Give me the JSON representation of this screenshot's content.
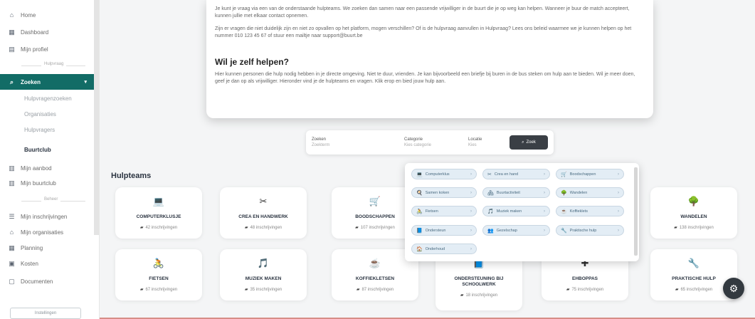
{
  "sidebar": {
    "items": [
      {
        "label": "Home",
        "icon": "home-icon",
        "glyph": "⌂"
      },
      {
        "label": "Dashboard",
        "icon": "dashboard-icon",
        "glyph": "▦"
      },
      {
        "label": "Mijn profiel",
        "icon": "profile-icon",
        "glyph": "▤"
      }
    ],
    "section_hulpvraag": "Hulpvraag",
    "active": {
      "label": "Zoeken",
      "icon": "search-icon",
      "glyph": "⌕"
    },
    "sub_items": [
      "Hulpvragenzoeken",
      "Organisaties",
      "Hulpvragers",
      "Buurtclub"
    ],
    "more_items": [
      {
        "label": "Mijn aanbod",
        "icon": "offer-icon",
        "glyph": "▥"
      },
      {
        "label": "Mijn buurtclub",
        "icon": "club-icon",
        "glyph": "▥"
      }
    ],
    "section_beheer": "Beheer",
    "beheer_items": [
      {
        "label": "Mijn inschrijvingen",
        "icon": "signup-icon",
        "glyph": "☰"
      },
      {
        "label": "Mijn organisaties",
        "icon": "organisation-icon",
        "glyph": "⌂"
      },
      {
        "label": "Planning",
        "icon": "calendar-icon",
        "glyph": "▦"
      },
      {
        "label": "Kosten",
        "icon": "costs-icon",
        "glyph": "▣"
      },
      {
        "label": "Documenten",
        "icon": "documents-icon",
        "glyph": "▢"
      }
    ],
    "bottom_button": "Instellingen"
  },
  "info": {
    "p1": "Je kunt je vraag via een van de onderstaande hulpteams. We zoeken dan samen naar een passende vrijwilliger in de buurt die je op weg kan helpen. Wanneer je buur de match accepteert, kunnen jullie met elkaar contact opnemen.",
    "p2": "Zijn er vragen die niet duidelijk zijn en niet zo opvallen op het platform, mogen verschillen? Of is de hulpvraag aanvullen in Hulpvraag? Lees ons beleid waarmee we je kunnen helpen op het nummer 010 123 45 67 of stuur een mailtje naar support@buurt.be",
    "heading": "Wil je zelf helpen?",
    "p3": "Hier kunnen personen die hulp nodig hebben in je directe omgeving. Niet te duur, vrienden. Je kan bijvoorbeeld een briefje bij buren in de bus steken om hulp aan te bieden. Wil je meer doen, geef je dan op als vrijwilliger. Hieronder vind je de hulpteams en vragen. Klik erop en bied jouw hulp aan."
  },
  "search": {
    "label_zoeken": "Zoeken",
    "value_zoeken": "Zoekterm",
    "label_categorie": "Categorie",
    "value_categorie": "Kies categorie",
    "label_locatie": "Locatie",
    "value_locatie": "Kies",
    "button": "Zoek"
  },
  "section_title": "Hulpteams",
  "teams": [
    {
      "name": "COMPUTERKLUSJE",
      "count": "42 inschrijvingen",
      "emoji": "💻"
    },
    {
      "name": "CREA EN HANDWERK",
      "count": "48 inschrijvingen",
      "emoji": "✂"
    },
    {
      "name": "BOODSCHAPPEN",
      "count": "107 inschrijvingen",
      "emoji": "🛒"
    },
    {
      "name": "WANDELEN",
      "count": "138 inschrijvingen",
      "emoji": "🌳"
    },
    {
      "name": "FIETSEN",
      "count": "67 inschrijvingen",
      "emoji": "🚴"
    },
    {
      "name": "MUZIEK MAKEN",
      "count": "35 inschrijvingen",
      "emoji": "🎵"
    },
    {
      "name": "KOFFIEKLETSEN",
      "count": "87 inschrijvingen",
      "emoji": "☕"
    },
    {
      "name": "ONDERSTEUNING BIJ SCHOOLWERK",
      "count": "18 inschrijvingen",
      "emoji": "📘"
    },
    {
      "name": "EHBOPPAS",
      "count": "75 inschrijvingen",
      "emoji": "✚"
    },
    {
      "name": "PRAKTISCHE HULP",
      "count": "65 inschrijvingen",
      "emoji": "🔧"
    }
  ],
  "chips": [
    {
      "label": "Computerklus",
      "emoji": "💻"
    },
    {
      "label": "Crea en hand",
      "emoji": "✂"
    },
    {
      "label": "Boodschappen",
      "emoji": "🛒"
    },
    {
      "label": "Samen koken",
      "emoji": "🍳"
    },
    {
      "label": "Buurtactiviteit",
      "emoji": "🏘"
    },
    {
      "label": "Wandelen",
      "emoji": "🌳"
    },
    {
      "label": "Fietsen",
      "emoji": "🚴"
    },
    {
      "label": "Muziek maken",
      "emoji": "🎵"
    },
    {
      "label": "Koffieklets",
      "emoji": "☕"
    },
    {
      "label": "Ondersteun",
      "emoji": "📘"
    },
    {
      "label": "Gezelschap",
      "emoji": "👥"
    },
    {
      "label": "Praktische hulp",
      "emoji": "🔧"
    },
    {
      "label": "Onderhoud",
      "emoji": "🏠"
    }
  ],
  "fab_icon": "⚙"
}
